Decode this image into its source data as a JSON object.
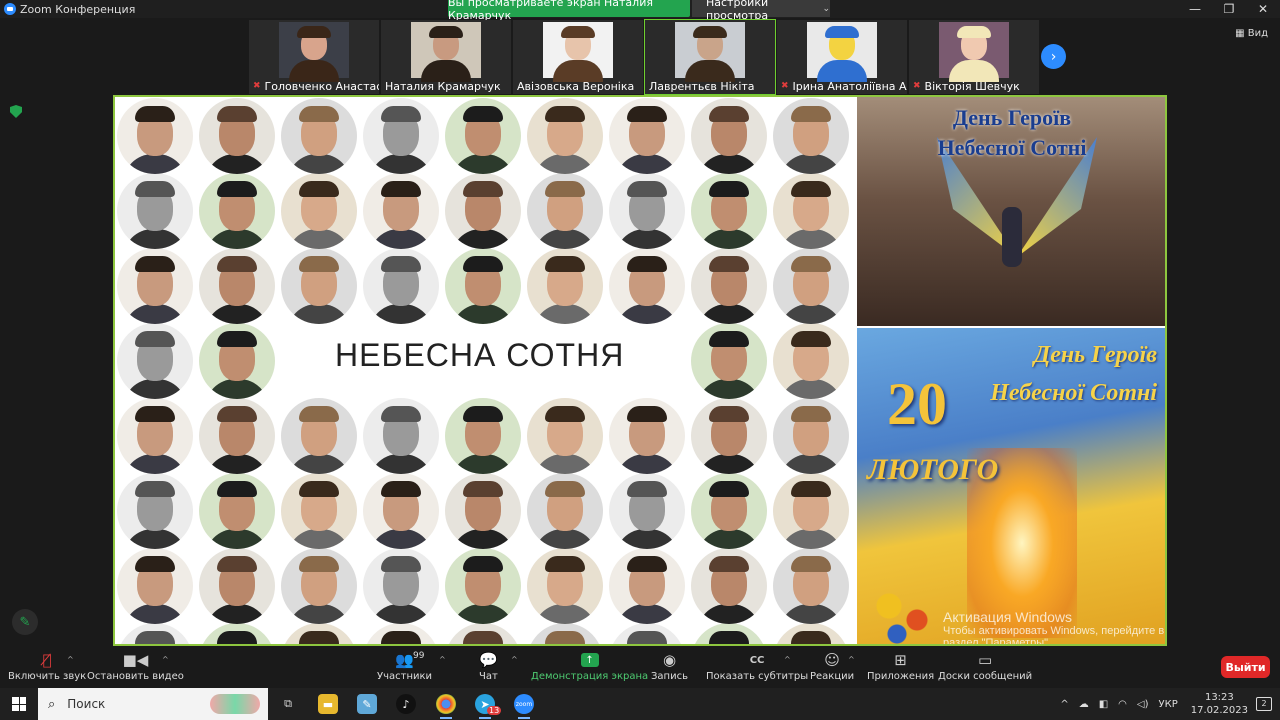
{
  "window": {
    "title": "Zoom Конференция",
    "share_banner": "Вы просматриваете экран Наталия Крамарчук",
    "view_settings": "Настройки просмотра",
    "view_label": "Вид"
  },
  "participants": [
    {
      "name": "Головченко Анастасия",
      "muted": true,
      "active": false,
      "bg": "#3c3f48",
      "skin": "#d8a48c",
      "hair": "#3a2618"
    },
    {
      "name": "Наталия Крамарчук",
      "muted": false,
      "active": false,
      "bg": "#cfc7b9",
      "skin": "#c89a80",
      "hair": "#2a2018"
    },
    {
      "name": "Авізовська Вероніка",
      "muted": false,
      "active": false,
      "bg": "#f2f2f2",
      "skin": "#e7c4ab",
      "hair": "#5a3c26"
    },
    {
      "name": "Лаврентьєв Нікіта",
      "muted": false,
      "active": true,
      "bg": "#c9cdd2",
      "skin": "#c9a48a",
      "hair": "#3a2a1c"
    },
    {
      "name": "Ірина Анатоліївна Ал...",
      "muted": true,
      "active": false,
      "bg": "#e9e9e9",
      "skin": "#f3d341",
      "hair": "#2f6fd0"
    },
    {
      "name": "Вікторія Шевчук",
      "muted": true,
      "active": false,
      "bg": "#7a5a70",
      "skin": "#f0c9b0",
      "hair": "#f2e7b8"
    }
  ],
  "slide": {
    "grid_title": "НЕБЕСНА СОТНЯ",
    "poster_top_line1": "День Героїв",
    "poster_top_line2": "Небесної Сотні",
    "poster_bottom_line1": "День Героїв",
    "poster_bottom_line2": "Небесної Сотні",
    "day": "20",
    "month": "ЛЮТОГО"
  },
  "activation": {
    "title": "Активация Windows",
    "text": "Чтобы активировать Windows, перейдите в раздел \"Параметры\"."
  },
  "toolbar": {
    "mute": "Включить звук",
    "video": "Остановить видео",
    "participants": "Участники",
    "participants_count": "99",
    "chat": "Чат",
    "share": "Демонстрация экрана",
    "record": "Запись",
    "captions": "Показать субтитры",
    "reactions": "Реакции",
    "apps": "Приложения",
    "whiteboards": "Доски сообщений",
    "leave": "Выйти"
  },
  "taskbar": {
    "search_placeholder": "Поиск",
    "language": "УКР",
    "time": "13:23",
    "date": "17.02.2023",
    "telegram_badge": "13",
    "notifications": "2"
  },
  "colors": {
    "share_green": "#23a44f",
    "slide_border": "#8ec63f",
    "leave_red": "#e02828",
    "zoom_blue": "#2d8cff"
  }
}
